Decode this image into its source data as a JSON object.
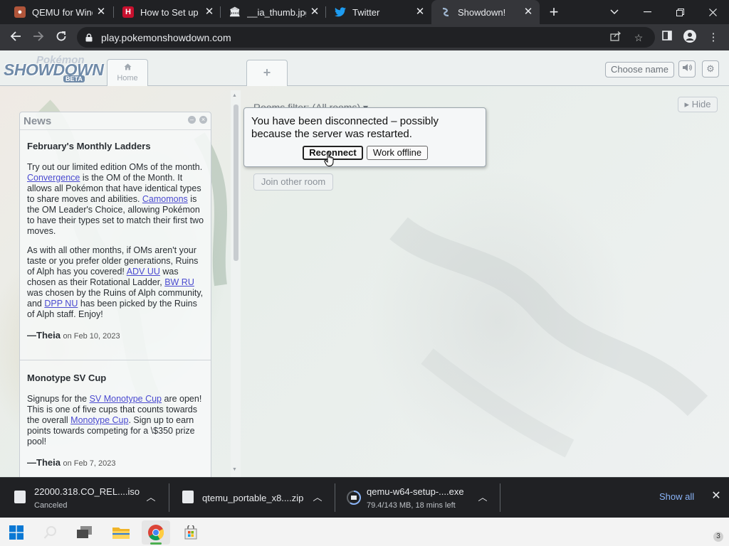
{
  "browser": {
    "tabs": [
      {
        "title": "QEMU for Wind",
        "active": false
      },
      {
        "title": "How to Set up V",
        "active": false
      },
      {
        "title": "__ia_thumb.jpg",
        "active": false
      },
      {
        "title": "Twitter",
        "active": false
      },
      {
        "title": "Showdown!",
        "active": true
      }
    ],
    "new_tab_glyph": "+",
    "url": "play.pokemonshowdown.com"
  },
  "header": {
    "logo": {
      "line1": "Pokémon",
      "line2": "SHOWDOWN",
      "line3": "BETA"
    },
    "home_tab": "Home",
    "plus_tab": "+",
    "choose_name": "Choose name"
  },
  "news": {
    "title": "News",
    "items": [
      {
        "title": "February's Monthly Ladders",
        "p1_a": "Try out our limited edition OMs of the month. ",
        "p1_link1": "Convergence",
        "p1_b": " is the OM of the Month. It allows all Pokémon that have identical types to share moves and abilities. ",
        "p1_link2": "Camomons",
        "p1_c": " is the OM Leader's Choice, allowing Pokémon to have their types set to match their first two moves.",
        "p2_a": "As with all other months, if OMs aren't your taste or you prefer older generations, Ruins of Alph has you covered! ",
        "p2_link1": "ADV UU",
        "p2_b": " was chosen as their Rotational Ladder, ",
        "p2_link2": "BW RU",
        "p2_c": " was chosen by the Ruins of Alph community, and ",
        "p2_link3": "DPP NU",
        "p2_d": " has been picked by the Ruins of Alph staff. Enjoy!",
        "author": "—Theia",
        "date": "on Feb 10, 2023"
      },
      {
        "title": "Monotype SV Cup",
        "p1_a": "Signups for the ",
        "p1_link1": "SV Monotype Cup",
        "p1_b": " are open! This is one of five cups that counts towards the overall ",
        "p1_link2": "Monotype Cup",
        "p1_c": ". Sign up to earn points towards competing for a \\$350 prize pool!",
        "author": "—Theia",
        "date": "on Feb 7, 2023"
      }
    ]
  },
  "main": {
    "rooms_filter": "Rooms filter: (All rooms) ▾",
    "hide_button": "Hide",
    "join_other_room": "Join other room"
  },
  "popup": {
    "message": "You have been disconnected – possibly because the server was restarted.",
    "reconnect": "Reconnect",
    "work_offline": "Work offline"
  },
  "downloads": {
    "items": [
      {
        "name": "22000.318.CO_REL....iso",
        "status": "Canceled"
      },
      {
        "name": "qtemu_portable_x8....zip",
        "status": ""
      },
      {
        "name": "qemu-w64-setup-....exe",
        "status": "79.4/143 MB, 18 mins left"
      }
    ],
    "show_all": "Show all"
  },
  "taskbar": {
    "notification_count": "3"
  },
  "colors": {
    "chrome_dark": "#202124",
    "chrome_toolbar": "#35363a",
    "link": "#4a4ad0",
    "show_all": "#8ab4f8"
  }
}
